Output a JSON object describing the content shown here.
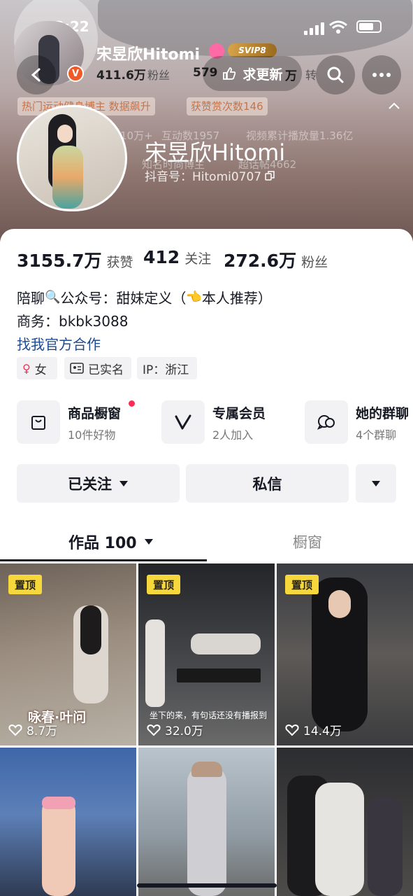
{
  "status": {
    "time": "13:22"
  },
  "top_bar": {
    "name_overlay": "宋昱欣Hitomi",
    "fans_overlay_num": "411.6万",
    "fans_overlay_lbl": "粉丝",
    "overlay_579": "579",
    "update_request": "求更新",
    "overlay_wan": "万",
    "overlay_zhuan": "转",
    "svip": "SVIP8"
  },
  "banner": {
    "pill1": "热门运动健身博主 数据飙升",
    "pill2": "获赞赏次数146",
    "ghost1": "10万+",
    "ghost2": "互动数1957",
    "ghost3": "视频累计播放量1.36亿",
    "ghost4": "知名时尚博主",
    "ghost5": "超话帖4662"
  },
  "profile": {
    "name": "宋昱欣Hitomi",
    "douyin_id": "抖音号：Hitomi0707"
  },
  "stats": [
    {
      "num": "3155.7万",
      "label": "获赞"
    },
    {
      "num": "412",
      "label": "关注"
    },
    {
      "num": "272.6万",
      "label": "粉丝"
    }
  ],
  "bio": {
    "line1_a": "陪聊",
    "line1_b": "公众号：甜妹定义（",
    "line1_c": "本人推荐）",
    "line2": "商务：bkbk3088",
    "link": "找我官方合作"
  },
  "tags": {
    "gender": "女",
    "verified": "已实名",
    "ip": "IP：浙江"
  },
  "features": [
    {
      "title": "商品橱窗",
      "sub": "10件好物",
      "icon": "bag-icon"
    },
    {
      "title": "专属会员",
      "sub": "2人加入",
      "icon": "v-icon"
    },
    {
      "title": "她的群聊",
      "sub": "4个群聊",
      "icon": "chat-icon"
    }
  ],
  "buttons": {
    "followed": "已关注",
    "message": "私信"
  },
  "tabs": {
    "works": "作品 100",
    "showcase": "橱窗"
  },
  "grid": [
    {
      "pinned": "置顶",
      "likes": "8.7万",
      "caption": "咏春·叶问"
    },
    {
      "pinned": "置顶",
      "likes": "32.0万",
      "caption": "坐下的来，有句话还没有播报到"
    },
    {
      "pinned": "置顶",
      "likes": "14.4万",
      "caption": ""
    },
    {
      "pinned": "",
      "likes": "",
      "caption": ""
    },
    {
      "pinned": "",
      "likes": "",
      "caption": ""
    },
    {
      "pinned": "",
      "likes": "",
      "caption": ""
    }
  ],
  "colors": {
    "link": "#1d4a8f",
    "pin": "#f7d83c",
    "dot": "#fe2c55",
    "verified": "#f05a28"
  }
}
